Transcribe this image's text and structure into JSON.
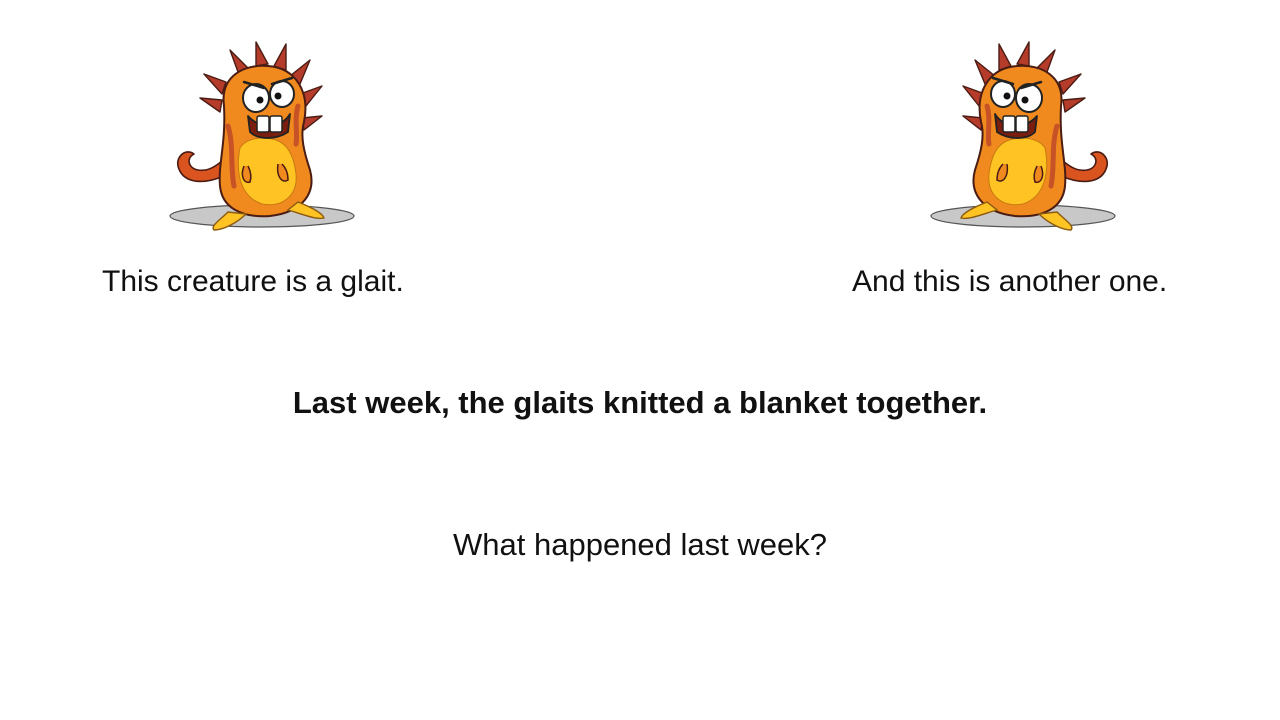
{
  "slide": {
    "caption_left": "This creature is a glait.",
    "caption_right": "And this is another one.",
    "statement": "Last week, the glaits knitted a blanket together.",
    "question": "What happened  last week?"
  },
  "creatures": {
    "left_icon": "glait-creature-icon",
    "right_icon": "glait-creature-icon",
    "colors": {
      "body_orange": "#f08a1e",
      "belly_yellow": "#ffc324",
      "spine_red": "#b53b2a",
      "shadow_gray": "#c8c8c8"
    }
  }
}
